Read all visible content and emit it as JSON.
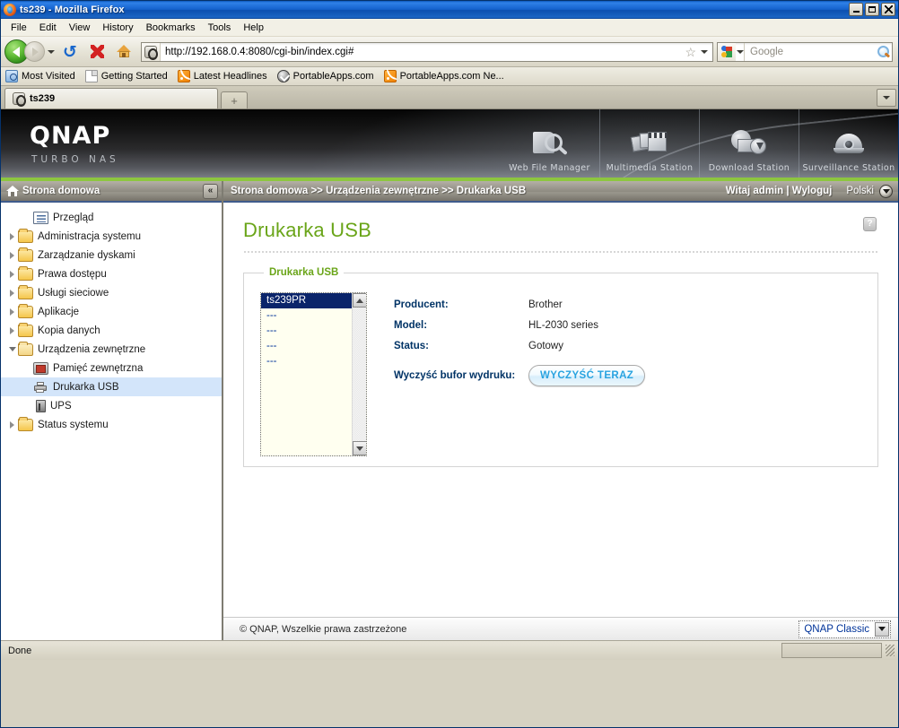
{
  "window": {
    "title": "ts239 - Mozilla Firefox",
    "minimize": "_",
    "maximize": "□",
    "close": "×"
  },
  "menubar": [
    {
      "label": "File"
    },
    {
      "label": "Edit"
    },
    {
      "label": "View"
    },
    {
      "label": "History"
    },
    {
      "label": "Bookmarks"
    },
    {
      "label": "Tools"
    },
    {
      "label": "Help"
    }
  ],
  "toolbar": {
    "url": "http://192.168.0.4:8080/cgi-bin/index.cgi#",
    "star": "☆",
    "search_placeholder": "Google",
    "search_value": ""
  },
  "bookmarks": [
    {
      "label": "Most Visited",
      "icon": "most-visited-icon"
    },
    {
      "label": "Getting Started",
      "icon": "page-icon"
    },
    {
      "label": "Latest Headlines",
      "icon": "rss-icon"
    },
    {
      "label": "PortableApps.com",
      "icon": "portableapps-icon"
    },
    {
      "label": "PortableApps.com Ne...",
      "icon": "rss-icon"
    }
  ],
  "tabs": {
    "active": "ts239",
    "new_tab_label": "+",
    "list_all_label": "▾"
  },
  "banner": {
    "logo": "QNAP",
    "tagline": "TURBO NAS",
    "stations": [
      {
        "label": "Web File Manager",
        "icon": "web-file-manager-icon"
      },
      {
        "label": "Multimedia Station",
        "icon": "multimedia-station-icon"
      },
      {
        "label": "Download Station",
        "icon": "download-station-icon"
      },
      {
        "label": "Surveillance Station",
        "icon": "surveillance-station-icon"
      }
    ]
  },
  "sidebar": {
    "header": "Strona domowa",
    "collapse_label": "«",
    "items": [
      {
        "label": "Przegląd",
        "icon": "overview-icon",
        "indent": 1,
        "twisty": "none",
        "selected": false
      },
      {
        "label": "Administracja systemu",
        "icon": "folder-icon",
        "indent": 0,
        "twisty": "right",
        "selected": false
      },
      {
        "label": "Zarządzanie dyskami",
        "icon": "folder-icon",
        "indent": 0,
        "twisty": "right",
        "selected": false
      },
      {
        "label": "Prawa dostępu",
        "icon": "folder-icon",
        "indent": 0,
        "twisty": "right",
        "selected": false
      },
      {
        "label": "Usługi sieciowe",
        "icon": "folder-icon",
        "indent": 0,
        "twisty": "right",
        "selected": false
      },
      {
        "label": "Aplikacje",
        "icon": "folder-icon",
        "indent": 0,
        "twisty": "right",
        "selected": false
      },
      {
        "label": "Kopia danych",
        "icon": "folder-icon",
        "indent": 0,
        "twisty": "right",
        "selected": false
      },
      {
        "label": "Urządzenia zewnętrzne",
        "icon": "folder-open-icon",
        "indent": 0,
        "twisty": "down",
        "selected": false
      },
      {
        "label": "Pamięć zewnętrzna",
        "icon": "external-storage-icon",
        "indent": 1,
        "twisty": "none",
        "selected": false
      },
      {
        "label": "Drukarka USB",
        "icon": "printer-icon",
        "indent": 1,
        "twisty": "none",
        "selected": true
      },
      {
        "label": "UPS",
        "icon": "ups-icon",
        "indent": 1,
        "twisty": "none",
        "selected": false
      },
      {
        "label": "Status systemu",
        "icon": "folder-icon",
        "indent": 0,
        "twisty": "right",
        "selected": false
      }
    ]
  },
  "breadcrumb": {
    "path": "Strona domowa >> Urządzenia zewnętrzne >> Drukarka USB",
    "greeting": "Witaj admin | Wyloguj",
    "language": "Polski"
  },
  "page": {
    "title": "Drukarka USB",
    "help_label": "?",
    "fieldset_legend": "Drukarka USB",
    "printer_list": [
      {
        "label": "ts239PR",
        "selected": true
      },
      {
        "label": "---",
        "selected": false
      },
      {
        "label": "---",
        "selected": false
      },
      {
        "label": "---",
        "selected": false
      },
      {
        "label": "---",
        "selected": false
      }
    ],
    "details": [
      {
        "label": "Producent:",
        "value": "Brother"
      },
      {
        "label": "Model:",
        "value": "HL-2030 series"
      },
      {
        "label": "Status:",
        "value": "Gotowy"
      }
    ],
    "clear_spool_label": "Wyczyść bufor wydruku:",
    "clear_button": "WYCZYŚĆ TERAZ"
  },
  "page_footer": {
    "copyright": "© QNAP, Wszelkie prawa zastrzeżone",
    "theme": "QNAP Classic"
  },
  "statusbar": {
    "text": "Done"
  },
  "colors": {
    "accent_green": "#8dc63f",
    "title_green": "#6aa519",
    "selection_blue": "#0a246a",
    "label_blue": "#003366",
    "button_blue": "#29a3e0"
  }
}
